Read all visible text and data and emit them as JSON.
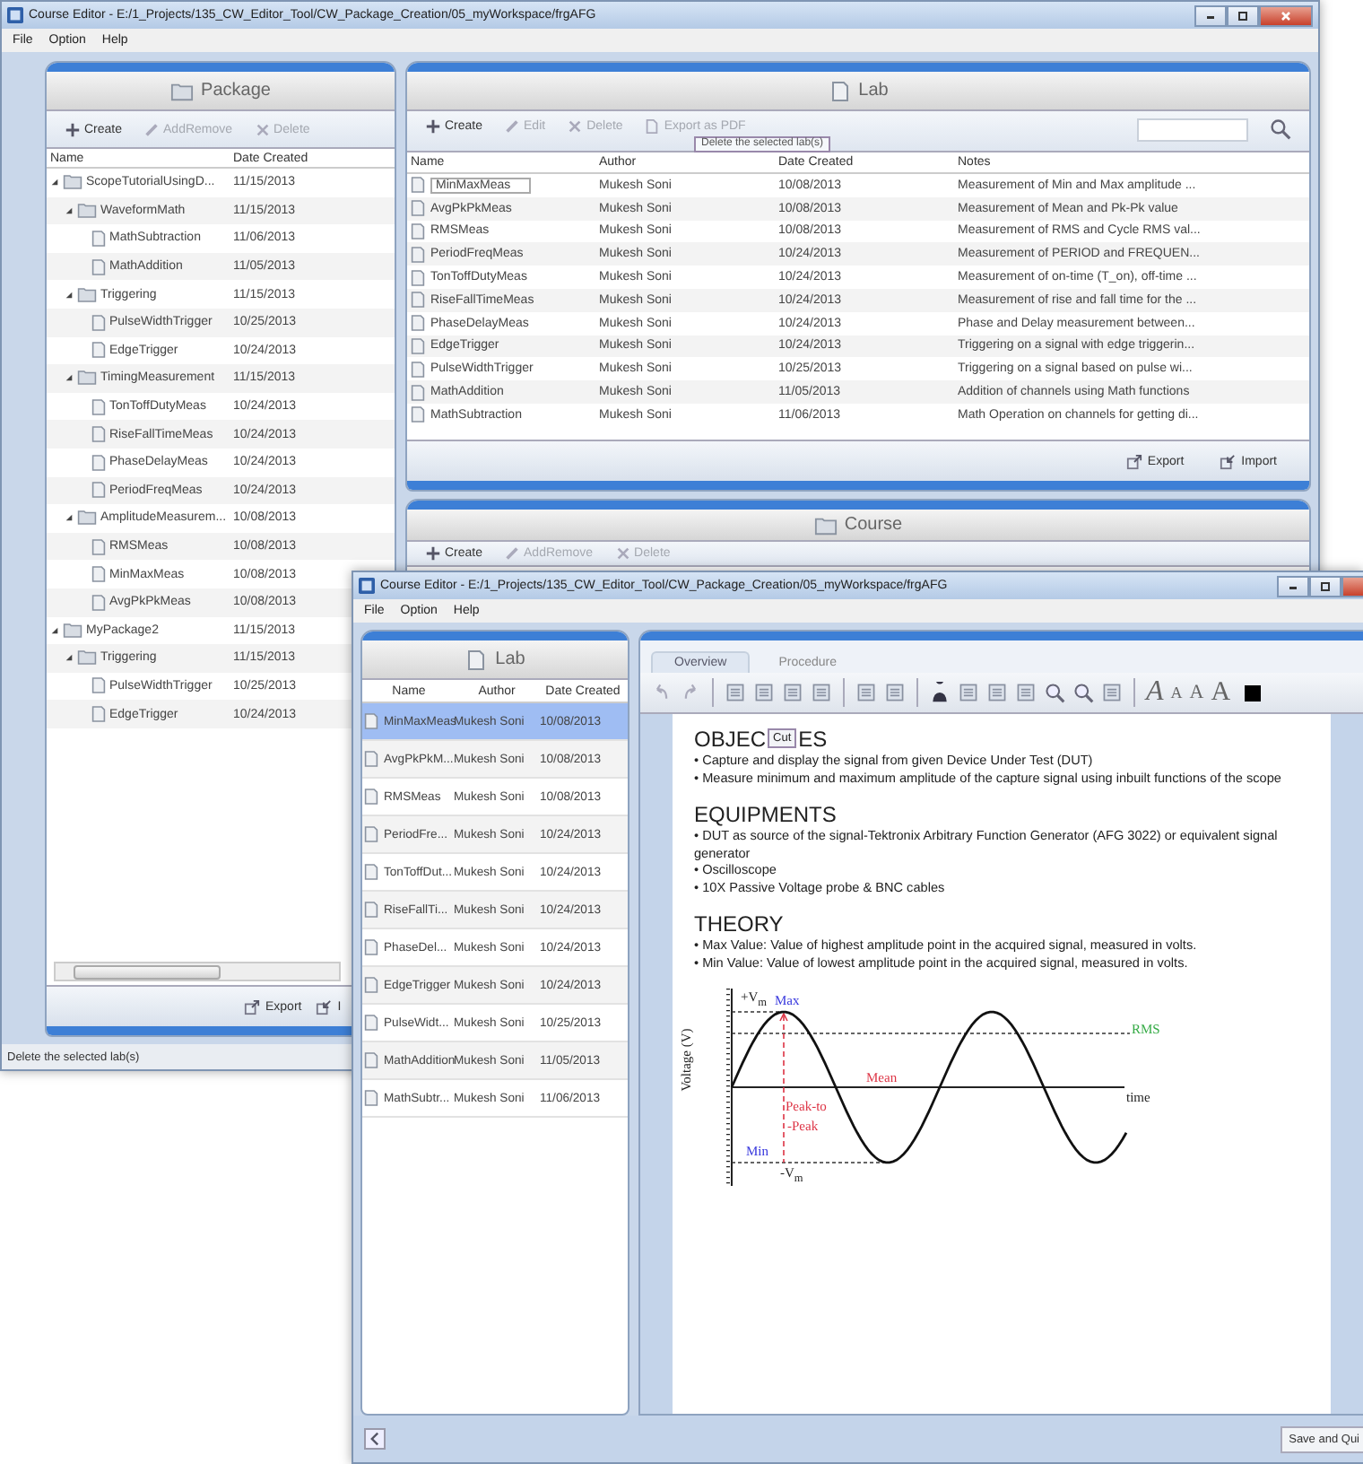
{
  "back_window": {
    "title": "Course Editor - E:/1_Projects/135_CW_Editor_Tool/CW_Package_Creation/05_myWorkspace/frgAFG",
    "menu": [
      "File",
      "Option",
      "Help"
    ],
    "package_panel": {
      "title": "Package",
      "toolbar": [
        {
          "kind": "create",
          "label": "Create",
          "disabled": false
        },
        {
          "kind": "edit",
          "label": "AddRemove",
          "disabled": true
        },
        {
          "kind": "delete",
          "label": "Delete",
          "disabled": true
        }
      ],
      "columns": [
        "Name",
        "Date Created"
      ],
      "tree": [
        {
          "name": "ScopeTutorialUsingD...",
          "date": "11/15/2013",
          "expanded": true,
          "children": [
            {
              "name": "WaveformMath",
              "date": "11/15/2013",
              "expanded": true,
              "children": [
                {
                  "name": "MathSubtraction",
                  "date": "11/06/2013"
                },
                {
                  "name": "MathAddition",
                  "date": "11/05/2013"
                }
              ]
            },
            {
              "name": "Triggering",
              "date": "11/15/2013",
              "expanded": true,
              "children": [
                {
                  "name": "PulseWidthTrigger",
                  "date": "10/25/2013"
                },
                {
                  "name": "EdgeTrigger",
                  "date": "10/24/2013"
                }
              ]
            },
            {
              "name": "TimingMeasurement",
              "date": "11/15/2013",
              "expanded": true,
              "children": [
                {
                  "name": "TonToffDutyMeas",
                  "date": "10/24/2013"
                },
                {
                  "name": "RiseFallTimeMeas",
                  "date": "10/24/2013"
                },
                {
                  "name": "PhaseDelayMeas",
                  "date": "10/24/2013"
                },
                {
                  "name": "PeriodFreqMeas",
                  "date": "10/24/2013"
                }
              ]
            },
            {
              "name": "AmplitudeMeasurem...",
              "date": "10/08/2013",
              "expanded": true,
              "children": [
                {
                  "name": "RMSMeas",
                  "date": "10/08/2013"
                },
                {
                  "name": "MinMaxMeas",
                  "date": "10/08/2013"
                },
                {
                  "name": "AvgPkPkMeas",
                  "date": "10/08/2013"
                }
              ]
            }
          ]
        },
        {
          "name": "MyPackage2",
          "date": "11/15/2013",
          "expanded": true,
          "children": [
            {
              "name": "Triggering",
              "date": "11/15/2013",
              "expanded": true,
              "children": [
                {
                  "name": "PulseWidthTrigger",
                  "date": "10/25/2013"
                },
                {
                  "name": "EdgeTrigger",
                  "date": "10/24/2013"
                }
              ]
            }
          ]
        }
      ],
      "footer": [
        {
          "kind": "export",
          "label": "Export"
        },
        {
          "kind": "import",
          "label": "I"
        }
      ]
    },
    "lab_panel": {
      "title": "Lab",
      "toolbar": [
        {
          "kind": "create",
          "label": "Create",
          "disabled": false
        },
        {
          "kind": "edit",
          "label": "Edit",
          "disabled": true
        },
        {
          "kind": "delete",
          "label": "Delete",
          "disabled": true
        },
        {
          "kind": "pdf",
          "label": "Export as PDF",
          "disabled": true
        }
      ],
      "tooltip": "Delete the selected lab(s)",
      "columns": [
        "Name",
        "Author",
        "Date Created",
        "Notes"
      ],
      "rows": [
        {
          "name": "MinMaxMeas",
          "author": "Mukesh Soni",
          "date": "10/08/2013",
          "notes": "Measurement of Min and Max amplitude ...",
          "editing": true
        },
        {
          "name": "AvgPkPkMeas",
          "author": "Mukesh Soni",
          "date": "10/08/2013",
          "notes": "Measurement of Mean and Pk-Pk value",
          "editing": false
        },
        {
          "name": "RMSMeas",
          "author": "Mukesh Soni",
          "date": "10/08/2013",
          "notes": "Measurement of RMS and Cycle RMS val...",
          "editing": false
        },
        {
          "name": "PeriodFreqMeas",
          "author": "Mukesh Soni",
          "date": "10/24/2013",
          "notes": "Measurement of PERIOD and FREQUEN...",
          "editing": false
        },
        {
          "name": "TonToffDutyMeas",
          "author": "Mukesh Soni",
          "date": "10/24/2013",
          "notes": "Measurement of on-time (T_on), off-time ...",
          "editing": false
        },
        {
          "name": "RiseFallTimeMeas",
          "author": "Mukesh Soni",
          "date": "10/24/2013",
          "notes": "Measurement of rise and fall time for the ...",
          "editing": false
        },
        {
          "name": "PhaseDelayMeas",
          "author": "Mukesh Soni",
          "date": "10/24/2013",
          "notes": "Phase and Delay measurement between...",
          "editing": false
        },
        {
          "name": "EdgeTrigger",
          "author": "Mukesh Soni",
          "date": "10/24/2013",
          "notes": "Triggering on a signal with edge triggerin...",
          "editing": false
        },
        {
          "name": "PulseWidthTrigger",
          "author": "Mukesh Soni",
          "date": "10/25/2013",
          "notes": "Triggering on a signal based on pulse wi...",
          "editing": false
        },
        {
          "name": "MathAddition",
          "author": "Mukesh Soni",
          "date": "11/05/2013",
          "notes": "Addition of channels using Math functions",
          "editing": false
        },
        {
          "name": "MathSubtraction",
          "author": "Mukesh Soni",
          "date": "11/06/2013",
          "notes": "Math Operation on channels for getting di...",
          "editing": false
        }
      ],
      "footer": [
        {
          "kind": "export",
          "label": "Export"
        },
        {
          "kind": "import",
          "label": "Import"
        }
      ]
    },
    "course_panel": {
      "title": "Course",
      "toolbar": [
        {
          "kind": "create",
          "label": "Create",
          "disabled": false
        },
        {
          "kind": "edit",
          "label": "AddRemove",
          "disabled": true
        },
        {
          "kind": "delete",
          "label": "Delete",
          "disabled": true
        }
      ]
    },
    "status_bar": "Delete the selected lab(s)"
  },
  "front_window": {
    "title": "Course Editor - E:/1_Projects/135_CW_Editor_Tool/CW_Package_Creation/05_myWorkspace/frgAFG",
    "menu": [
      "File",
      "Option",
      "Help"
    ],
    "lab_list": {
      "title": "Lab",
      "columns": [
        "Name",
        "Author",
        "Date Created"
      ],
      "rows": [
        {
          "name": "MinMaxMeas",
          "author": "Mukesh Soni",
          "date": "10/08/2013",
          "selected": true
        },
        {
          "name": "AvgPkPkM...",
          "author": "Mukesh Soni",
          "date": "10/08/2013",
          "selected": false
        },
        {
          "name": "RMSMeas",
          "author": "Mukesh Soni",
          "date": "10/08/2013",
          "selected": false
        },
        {
          "name": "PeriodFre...",
          "author": "Mukesh Soni",
          "date": "10/24/2013",
          "selected": false
        },
        {
          "name": "TonToffDut...",
          "author": "Mukesh Soni",
          "date": "10/24/2013",
          "selected": false
        },
        {
          "name": "RiseFallTi...",
          "author": "Mukesh Soni",
          "date": "10/24/2013",
          "selected": false
        },
        {
          "name": "PhaseDel...",
          "author": "Mukesh Soni",
          "date": "10/24/2013",
          "selected": false
        },
        {
          "name": "EdgeTrigger",
          "author": "Mukesh Soni",
          "date": "10/24/2013",
          "selected": false
        },
        {
          "name": "PulseWidt...",
          "author": "Mukesh Soni",
          "date": "10/25/2013",
          "selected": false
        },
        {
          "name": "MathAddition",
          "author": "Mukesh Soni",
          "date": "11/05/2013",
          "selected": false
        },
        {
          "name": "MathSubtr...",
          "author": "Mukesh Soni",
          "date": "11/06/2013",
          "selected": false
        }
      ]
    },
    "editor": {
      "tabs": [
        {
          "label": "Overview",
          "selected": true
        },
        {
          "label": "Procedure",
          "selected": false
        }
      ],
      "font_buttons": [
        "A",
        "A",
        "A",
        "A"
      ],
      "sections": [
        {
          "heading": [
            "OBJEC",
            "ES"
          ],
          "tooltip": "Cut",
          "bullets": [
            "• Capture and display the signal from given Device Under Test (DUT)",
            "• Measure minimum and maximum amplitude of the capture signal using inbuilt functions of the scope"
          ]
        },
        {
          "heading": [
            "EQUIPMENTS"
          ],
          "bullets": [
            "• DUT as source of the signal-Tektronix Arbitrary Function Generator (AFG 3022) or equivalent signal generator",
            "• Oscilloscope",
            "• 10X Passive Voltage probe & BNC cables"
          ]
        },
        {
          "heading": [
            "THEORY"
          ],
          "bullets": [
            "• Max Value: Value of highest amplitude point in the acquired signal, measured in volts.",
            "• Min Value: Value of lowest amplitude point in the acquired signal, measured in volts."
          ]
        }
      ],
      "diagram_labels": [
        {
          "text": "Voltage (V)",
          "color": "#222222"
        },
        {
          "text": "+V$_{m}$",
          "color": "#222222"
        },
        {
          "text": "Max",
          "color": "#3333dd"
        },
        {
          "text": "RMS",
          "color": "#33aa44"
        },
        {
          "text": "Mean",
          "color": "#dd3344"
        },
        {
          "text": "time",
          "color": "#222222"
        },
        {
          "text": "Peak-to",
          "color": "#dd3344"
        },
        {
          "text": "-Peak",
          "color": "#dd3344"
        },
        {
          "text": "Min",
          "color": "#3333dd"
        },
        {
          "text": "-V$_{m}$",
          "color": "#222222"
        }
      ],
      "save_button": "Save and Qui"
    }
  }
}
